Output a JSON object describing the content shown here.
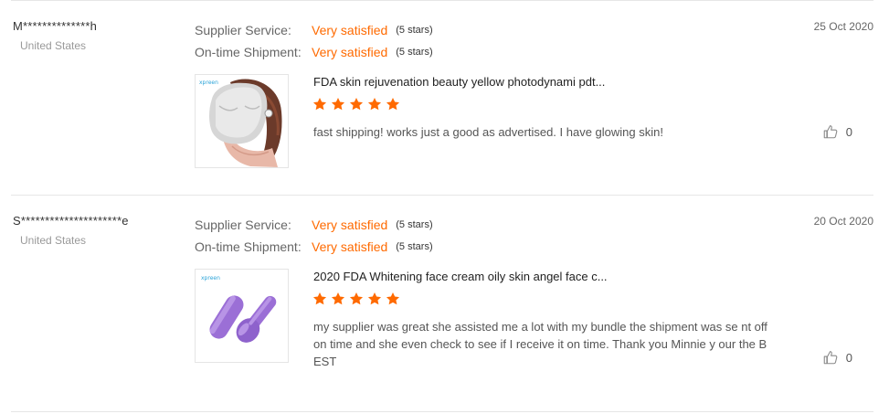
{
  "reviews": [
    {
      "reviewer": "M**************h",
      "country": "United States",
      "date": "25 Oct 2020",
      "supplier_label": "Supplier Service:",
      "supplier_value": "Very satisfied",
      "supplier_stars": "(5 stars)",
      "shipment_label": "On-time Shipment:",
      "shipment_value": "Very satisfied",
      "shipment_stars": "(5 stars)",
      "product_title": "FDA skin rejuvenation beauty yellow photodynami pdt...",
      "product_brand": "xpreen",
      "product_image": "led-face-mask-photo",
      "rating": 5,
      "feedback": "fast shipping! works just a good as advertised. I have glowing skin!",
      "likes": "0"
    },
    {
      "reviewer": "S*********************e",
      "country": "United States",
      "date": "20 Oct 2020",
      "supplier_label": "Supplier Service:",
      "supplier_value": "Very satisfied",
      "supplier_stars": "(5 stars)",
      "shipment_label": "On-time Shipment:",
      "shipment_value": "Very satisfied",
      "shipment_stars": "(5 stars)",
      "product_title": "2020 FDA Whitening face cream oily skin angel face c...",
      "product_brand": "xpreen",
      "product_image": "purple-face-roller-photo",
      "rating": 5,
      "feedback": "my supplier was great she assisted me a lot with my bundle the shipment was se nt off on time and she even check to see if I receive it on time. Thank you Minnie y our the BEST",
      "likes": "0"
    }
  ],
  "colors": {
    "accent": "#ff6a00",
    "star": "#ff6a00",
    "divider": "#e6e6e6"
  },
  "icons": {
    "rating_star": "star-icon",
    "like": "thumbs-up-icon"
  }
}
